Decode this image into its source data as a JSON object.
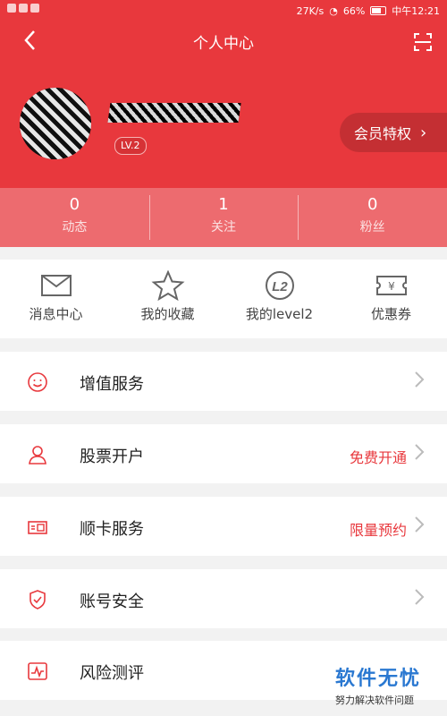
{
  "status": {
    "network_speed": "27K/s",
    "battery": "66%",
    "time": "中午12:21"
  },
  "header": {
    "title": "个人中心"
  },
  "profile": {
    "level": "LV.2",
    "vip_label": "会员特权"
  },
  "stats": [
    {
      "value": "0",
      "label": "动态"
    },
    {
      "value": "1",
      "label": "关注"
    },
    {
      "value": "0",
      "label": "粉丝"
    }
  ],
  "quick_actions": [
    {
      "label": "消息中心",
      "icon": "mail-icon"
    },
    {
      "label": "我的收藏",
      "icon": "star-icon"
    },
    {
      "label": "我的level2",
      "icon": "level2-icon"
    },
    {
      "label": "优惠券",
      "icon": "coupon-icon"
    }
  ],
  "menu": [
    {
      "label": "增值服务",
      "right": "",
      "icon": "smile-icon"
    },
    {
      "label": "股票开户",
      "right": "免费开通",
      "icon": "user-icon"
    },
    {
      "label": "顺卡服务",
      "right": "限量预约",
      "icon": "card-icon"
    },
    {
      "label": "账号安全",
      "right": "",
      "icon": "shield-icon"
    },
    {
      "label": "风险测评",
      "right": "",
      "icon": "chart-icon"
    }
  ],
  "watermark": {
    "title": "软件无忧",
    "subtitle": "努力解决软件问题"
  },
  "colors": {
    "brand_red": "#e8383d",
    "stats_bar": "#ed6b6f",
    "vip_button": "#c42f33",
    "watermark_blue": "#2a78d1"
  }
}
